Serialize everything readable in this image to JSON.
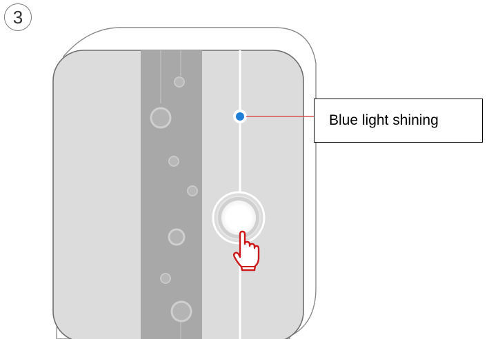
{
  "step": {
    "number": "3"
  },
  "callout": {
    "label": "Blue light shining"
  },
  "colors": {
    "indicator_light": "#1f7fd6",
    "leader_line": "#d9534f",
    "hand_pointer": "#cc1a1a",
    "device_face": "#dcdcdc",
    "device_strip": "#a8a8a8"
  },
  "icons": {
    "pointer": "hand-pointer-icon",
    "light": "blue-led-icon",
    "button": "round-push-button-icon"
  }
}
